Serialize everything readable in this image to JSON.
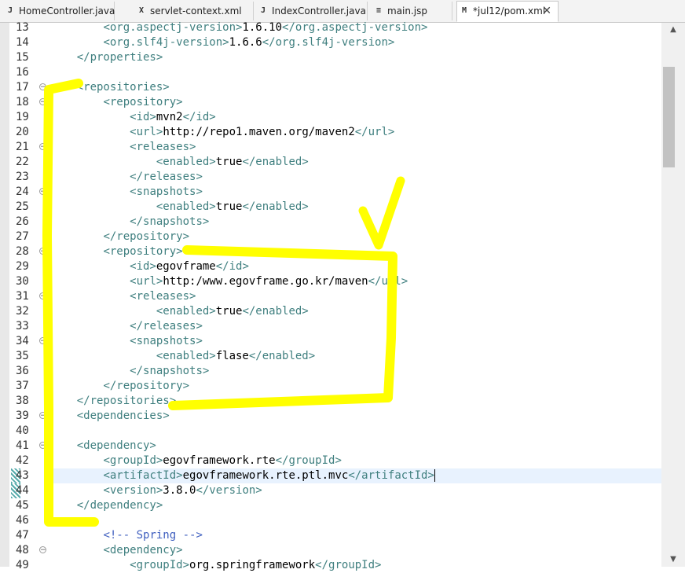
{
  "tabs": [
    {
      "label": "HomeController.java",
      "icon": "java-file-icon"
    },
    {
      "label": "servlet-context.xml",
      "icon": "xml-file-icon"
    },
    {
      "label": "IndexController.java",
      "icon": "java-file-icon"
    },
    {
      "label": "main.jsp",
      "icon": "jsp-file-icon"
    },
    {
      "label": "*jul12/pom.xml",
      "icon": "maven-file-icon",
      "active": true,
      "close": "✕"
    }
  ],
  "lines": [
    {
      "n": "13",
      "segs": [
        [
          "        ",
          "tx"
        ],
        [
          "<org.aspectj-version>",
          "tg"
        ],
        [
          "1.6.10",
          "tx"
        ],
        [
          "</org.aspectj-version>",
          "tg"
        ]
      ]
    },
    {
      "n": "14",
      "segs": [
        [
          "        ",
          "tx"
        ],
        [
          "<org.slf4j-version>",
          "tg"
        ],
        [
          "1.6.6",
          "tx"
        ],
        [
          "</org.slf4j-version>",
          "tg"
        ]
      ]
    },
    {
      "n": "15",
      "segs": [
        [
          "    ",
          "tx"
        ],
        [
          "</properties>",
          "tg"
        ]
      ]
    },
    {
      "n": "16",
      "segs": []
    },
    {
      "n": "17",
      "fold": true,
      "segs": [
        [
          "    ",
          "tx"
        ],
        [
          "<repositories>",
          "tg"
        ]
      ]
    },
    {
      "n": "18",
      "fold": true,
      "segs": [
        [
          "        ",
          "tx"
        ],
        [
          "<repository>",
          "tg"
        ]
      ]
    },
    {
      "n": "19",
      "segs": [
        [
          "            ",
          "tx"
        ],
        [
          "<id>",
          "tg"
        ],
        [
          "mvn2",
          "tx"
        ],
        [
          "</id>",
          "tg"
        ]
      ]
    },
    {
      "n": "20",
      "segs": [
        [
          "            ",
          "tx"
        ],
        [
          "<url>",
          "tg"
        ],
        [
          "http://repo1.maven.org/maven2",
          "tx"
        ],
        [
          "</url>",
          "tg"
        ]
      ]
    },
    {
      "n": "21",
      "fold": true,
      "segs": [
        [
          "            ",
          "tx"
        ],
        [
          "<releases>",
          "tg"
        ]
      ]
    },
    {
      "n": "22",
      "segs": [
        [
          "                ",
          "tx"
        ],
        [
          "<enabled>",
          "tg"
        ],
        [
          "true",
          "tx"
        ],
        [
          "</enabled>",
          "tg"
        ]
      ]
    },
    {
      "n": "23",
      "segs": [
        [
          "            ",
          "tx"
        ],
        [
          "</releases>",
          "tg"
        ]
      ]
    },
    {
      "n": "24",
      "fold": true,
      "segs": [
        [
          "            ",
          "tx"
        ],
        [
          "<snapshots>",
          "tg"
        ]
      ]
    },
    {
      "n": "25",
      "segs": [
        [
          "                ",
          "tx"
        ],
        [
          "<enabled>",
          "tg"
        ],
        [
          "true",
          "tx"
        ],
        [
          "</enabled>",
          "tg"
        ]
      ]
    },
    {
      "n": "26",
      "segs": [
        [
          "            ",
          "tx"
        ],
        [
          "</snapshots>",
          "tg"
        ]
      ]
    },
    {
      "n": "27",
      "segs": [
        [
          "        ",
          "tx"
        ],
        [
          "</repository>",
          "tg"
        ]
      ]
    },
    {
      "n": "28",
      "fold": true,
      "segs": [
        [
          "        ",
          "tx"
        ],
        [
          "<repository>",
          "tg"
        ]
      ]
    },
    {
      "n": "29",
      "segs": [
        [
          "            ",
          "tx"
        ],
        [
          "<id>",
          "tg"
        ],
        [
          "egovframe",
          "tx"
        ],
        [
          "</id>",
          "tg"
        ]
      ]
    },
    {
      "n": "30",
      "segs": [
        [
          "            ",
          "tx"
        ],
        [
          "<url>",
          "tg"
        ],
        [
          "http:/www.egovframe.go.kr/maven",
          "tx"
        ],
        [
          "</url>",
          "tg"
        ]
      ]
    },
    {
      "n": "31",
      "fold": true,
      "segs": [
        [
          "            ",
          "tx"
        ],
        [
          "<releases>",
          "tg"
        ]
      ]
    },
    {
      "n": "32",
      "segs": [
        [
          "                ",
          "tx"
        ],
        [
          "<enabled>",
          "tg"
        ],
        [
          "true",
          "tx"
        ],
        [
          "</enabled>",
          "tg"
        ]
      ]
    },
    {
      "n": "33",
      "segs": [
        [
          "            ",
          "tx"
        ],
        [
          "</releases>",
          "tg"
        ]
      ]
    },
    {
      "n": "34",
      "fold": true,
      "segs": [
        [
          "            ",
          "tx"
        ],
        [
          "<snapshots>",
          "tg"
        ]
      ]
    },
    {
      "n": "35",
      "segs": [
        [
          "                ",
          "tx"
        ],
        [
          "<enabled>",
          "tg"
        ],
        [
          "flase",
          "tx"
        ],
        [
          "</enabled>",
          "tg"
        ]
      ]
    },
    {
      "n": "36",
      "segs": [
        [
          "            ",
          "tx"
        ],
        [
          "</snapshots>",
          "tg"
        ]
      ]
    },
    {
      "n": "37",
      "segs": [
        [
          "        ",
          "tx"
        ],
        [
          "</repository>",
          "tg"
        ]
      ]
    },
    {
      "n": "38",
      "segs": [
        [
          "    ",
          "tx"
        ],
        [
          "</repositories>",
          "tg"
        ]
      ]
    },
    {
      "n": "39",
      "fold": true,
      "segs": [
        [
          "    ",
          "tx"
        ],
        [
          "<dependencies>",
          "tg"
        ]
      ]
    },
    {
      "n": "40",
      "segs": []
    },
    {
      "n": "41",
      "fold": true,
      "segs": [
        [
          "    ",
          "tx"
        ],
        [
          "<dependency>",
          "tg"
        ]
      ]
    },
    {
      "n": "42",
      "segs": [
        [
          "        ",
          "tx"
        ],
        [
          "<groupId>",
          "tg"
        ],
        [
          "egovframework.rte",
          "tx"
        ],
        [
          "</groupId>",
          "tg"
        ]
      ]
    },
    {
      "n": "43",
      "current": true,
      "marked": true,
      "segs": [
        [
          "        ",
          "tx"
        ],
        [
          "<artifactId>",
          "tg"
        ],
        [
          "egovframework.rte.ptl.mvc",
          "tx"
        ],
        [
          "</artifactId>",
          "tg"
        ]
      ],
      "caret": true
    },
    {
      "n": "44",
      "marked": true,
      "segs": [
        [
          "        ",
          "tx"
        ],
        [
          "<version>",
          "tg"
        ],
        [
          "3.8.0",
          "tx"
        ],
        [
          "</version>",
          "tg"
        ]
      ]
    },
    {
      "n": "45",
      "segs": [
        [
          "    ",
          "tx"
        ],
        [
          "</dependency>",
          "tg"
        ]
      ]
    },
    {
      "n": "46",
      "segs": []
    },
    {
      "n": "47",
      "segs": [
        [
          "        ",
          "tx"
        ],
        [
          "<!-- Spring -->",
          "cm"
        ]
      ]
    },
    {
      "n": "48",
      "fold": true,
      "segs": [
        [
          "        ",
          "tx"
        ],
        [
          "<dependency>",
          "tg"
        ]
      ]
    },
    {
      "n": "49",
      "segs": [
        [
          "            ",
          "tx"
        ],
        [
          "<groupId>",
          "tg"
        ],
        [
          "org.springframework",
          "tx"
        ],
        [
          "</groupId>",
          "tg"
        ]
      ]
    }
  ],
  "scroll": {
    "up": "▲",
    "down": "▼"
  },
  "colors": {
    "tag": "#3f7f7f",
    "text": "#000000",
    "comment": "#3f5fbf",
    "highlight": "#ffff00",
    "current_line": "#e8f2fe"
  }
}
